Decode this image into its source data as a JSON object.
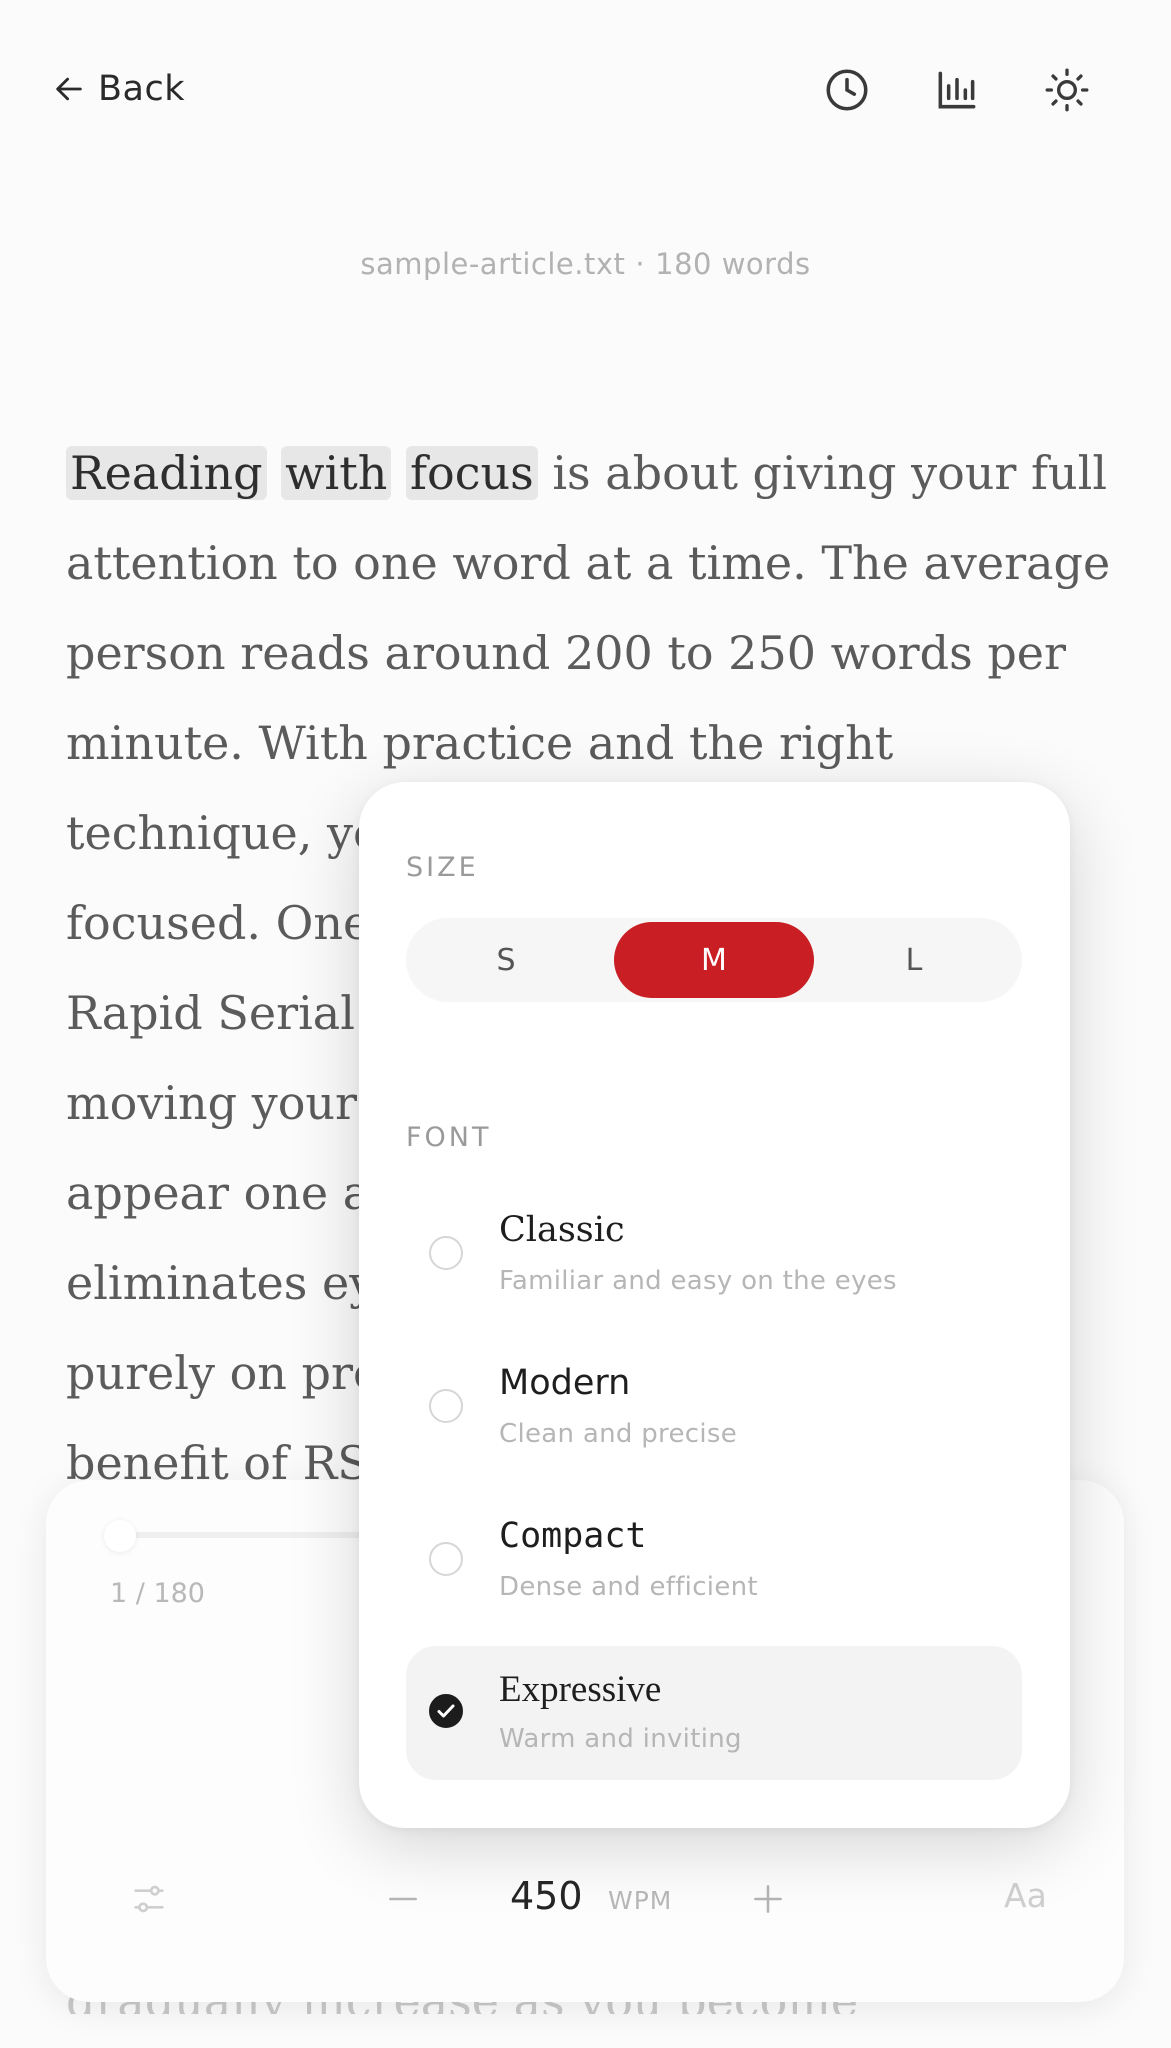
{
  "header": {
    "back_label": "Back",
    "icons": [
      "history-icon",
      "stats-icon",
      "theme-icon"
    ]
  },
  "file": {
    "name": "sample-article.txt",
    "separator": "·",
    "word_count": "180 words"
  },
  "article": {
    "lines": [
      [
        "Reading",
        "with",
        "focus",
        "is about giving your full"
      ],
      "attention to one word at a time. The average",
      "person reads around 200 to 250 words per",
      "minute. With practice and the right",
      "technique, yo",
      "focused. One",
      "Rapid Serial V",
      "moving your",
      "appear one a",
      "eliminates ey",
      "purely on pro",
      "benefit of RS"
    ],
    "tail_fragment": "gradually increase as you become"
  },
  "player": {
    "position_label": "1 / 180",
    "progress": 0.0,
    "wpm_value": "450",
    "wpm_unit": "WPM",
    "font_button_label": "Aa"
  },
  "settings": {
    "size_label": "SIZE",
    "sizes": [
      "S",
      "M",
      "L"
    ],
    "selected_size": "M",
    "font_label": "FONT",
    "fonts": [
      {
        "name": "Classic",
        "description": "Familiar and easy on the eyes",
        "selected": false
      },
      {
        "name": "Modern",
        "description": "Clean and precise",
        "selected": false
      },
      {
        "name": "Compact",
        "description": "Dense and efficient",
        "selected": false
      },
      {
        "name": "Expressive",
        "description": "Warm and inviting",
        "selected": true
      }
    ]
  },
  "colors": {
    "accent": "#c81e24",
    "background": "#fbfbfb",
    "text": "#5b5b5b",
    "highlight": "#e7e7e7"
  }
}
